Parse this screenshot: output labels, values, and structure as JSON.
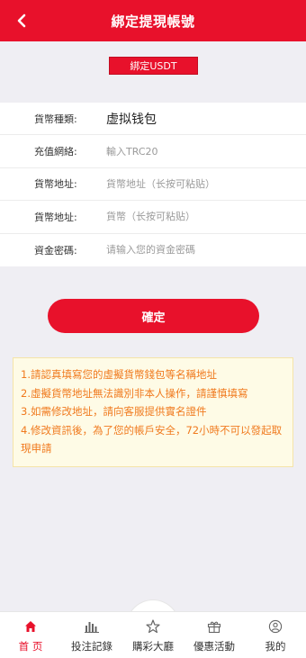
{
  "header": {
    "title": "綁定提現帳號"
  },
  "usdt_button": {
    "label": "綁定USDT"
  },
  "form": {
    "currency_type": {
      "label": "貨幣種類:",
      "value": "虚拟钱包"
    },
    "network": {
      "label": "充值網絡:",
      "placeholder": "輸入TRC20"
    },
    "address": {
      "label": "貨幣地址:",
      "placeholder": "貨幣地址（长按可粘贴）"
    },
    "address_confirm": {
      "label": "貨幣地址:",
      "placeholder": "貨幣（长按可粘贴）"
    },
    "fund_password": {
      "label": "資金密碼:",
      "placeholder": "请输入您的資金密碼"
    }
  },
  "confirm_button": {
    "label": "確定"
  },
  "notice": {
    "lines": [
      "1.請認真填寫您的虛擬貨幣錢包等名稱地址",
      "2.虛擬貨幣地址無法識別非本人操作，請謹慎填寫",
      "3.如需修改地址，請向客服提供實名證件",
      "4.修改資訊後，為了您的帳戶安全，72小時不可以發起取現申請"
    ]
  },
  "tabbar": {
    "items": [
      {
        "label": "首 页",
        "icon": "home-icon",
        "active": true
      },
      {
        "label": "投注記錄",
        "icon": "bar-chart-icon",
        "active": false
      },
      {
        "label": "購彩大廳",
        "icon": "star-icon",
        "active": false
      },
      {
        "label": "優惠活動",
        "icon": "gift-icon",
        "active": false
      },
      {
        "label": "我的",
        "icon": "user-icon",
        "active": false
      }
    ]
  },
  "colors": {
    "primary": "#e8112b",
    "notice_text": "#f07a1e",
    "notice_bg": "#fefbe6",
    "page_bg": "#efeef3"
  }
}
